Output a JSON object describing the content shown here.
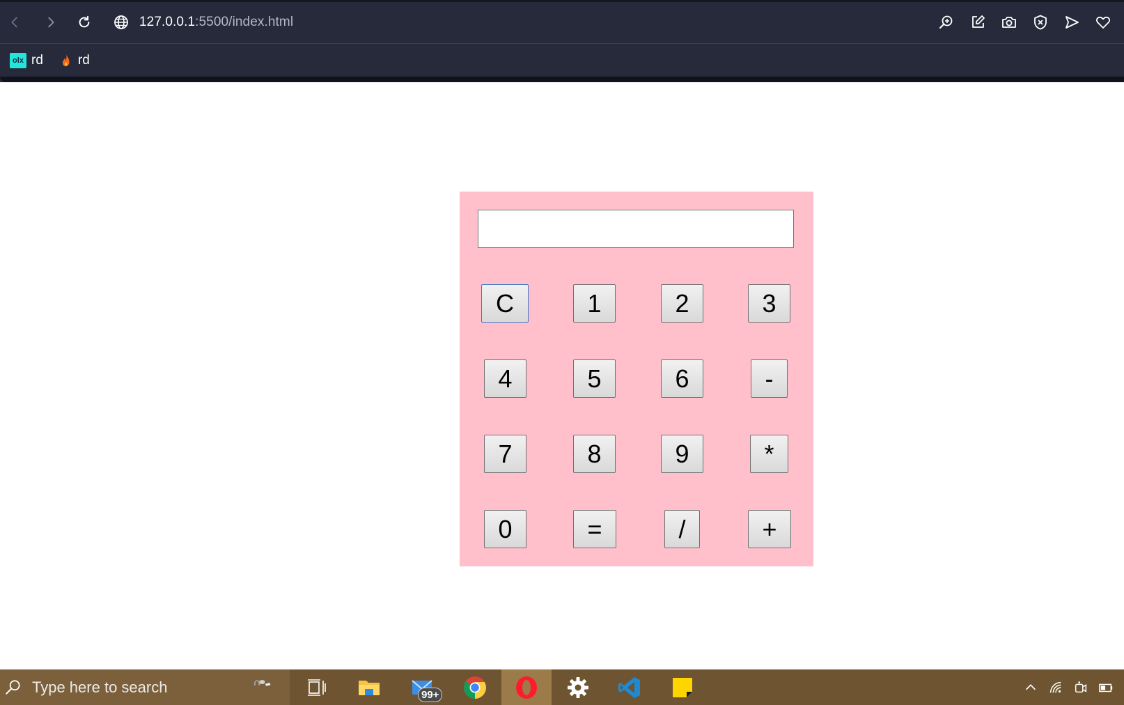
{
  "browser": {
    "url_host": "127.0.0.1",
    "url_path": ":5500/index.html",
    "bookmarks": [
      {
        "icon": "olx-icon",
        "badge": "olx",
        "label": "rd"
      },
      {
        "icon": "flame-icon",
        "label": "rd"
      }
    ],
    "toolbar_icons": [
      "back-icon",
      "forward-icon",
      "reload-icon",
      "globe-icon"
    ],
    "right_icons": [
      "zoom-icon",
      "edit-icon",
      "camera-icon",
      "shield-icon",
      "send-icon",
      "heart-icon"
    ]
  },
  "calculator": {
    "display_value": "",
    "background": "#ffc0cb",
    "keys": [
      [
        "C",
        "1",
        "2",
        "3"
      ],
      [
        "4",
        "5",
        "6",
        "-"
      ],
      [
        "7",
        "8",
        "9",
        "*"
      ],
      [
        "0",
        "=",
        "/",
        "+"
      ]
    ]
  },
  "taskbar": {
    "search_placeholder": "Type here to search",
    "mail_badge": "99+",
    "apps": [
      "task-view-icon",
      "file-explorer-icon",
      "mail-icon",
      "chrome-icon",
      "opera-icon",
      "settings-icon",
      "vscode-icon",
      "sticky-notes-icon"
    ],
    "tray": [
      "chevron-up-icon",
      "wifi-icon",
      "meet-now-icon",
      "battery-icon"
    ],
    "color": "#6e5430"
  }
}
